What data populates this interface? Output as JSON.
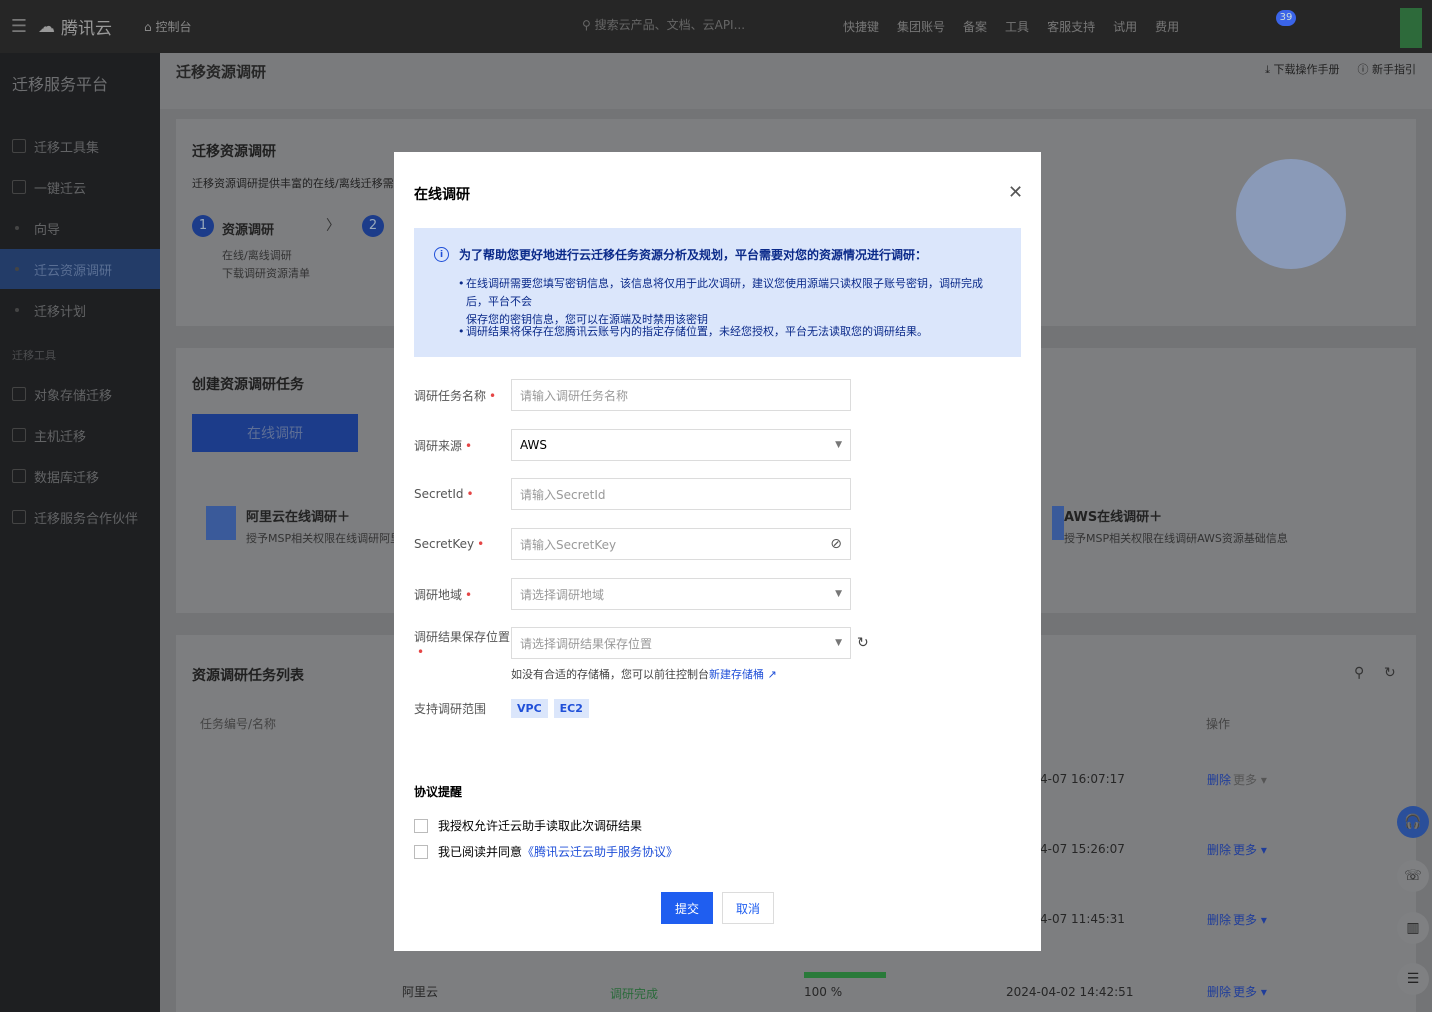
{
  "topbar": {
    "logo_text": "腾讯云",
    "console": "控制台",
    "search_placeholder": "搜索云产品、文档、云API...",
    "nav": [
      "快捷键",
      "集团账号",
      "备案",
      "工具",
      "客服支持",
      "试用",
      "费用"
    ],
    "notification_count": "39"
  },
  "sidebar": {
    "title": "迁移服务平台",
    "items": [
      "迁移工具集",
      "一键迁云",
      "向导",
      "迁云资源调研",
      "迁移计划"
    ],
    "section_label": "迁移工具",
    "tools": [
      "对象存储迁移",
      "主机迁移",
      "数据库迁移",
      "迁移服务合作伙伴"
    ]
  },
  "main": {
    "page_title": "迁移资源调研",
    "download_manual": "下载操作手册",
    "guide": "新手指引",
    "intro_title": "迁移资源调研",
    "intro_desc": "迁移资源调研提供丰富的在线/离线迁移需求调研",
    "step1_num": "1",
    "step1_title": "资源调研",
    "step1_desc1": "在线/离线调研",
    "step1_desc2": "下载调研资源清单",
    "step2_num": "2",
    "create_title": "创建资源调研任务",
    "create_tab": "在线调研",
    "aliyun_title": "阿里云在线调研＋",
    "aliyun_desc": "授予MSP相关权限在线调研阿里云",
    "aws_title": "AWS在线调研＋",
    "aws_desc": "授予MSP相关权限在线调研AWS资源基础信息",
    "list_title": "资源调研任务列表",
    "col_name": "任务编号/名称",
    "col_op": "操作",
    "rows": [
      {
        "time": "4-07 16:07:17",
        "del": "删除",
        "more": "更多"
      },
      {
        "time": "4-07 15:26:07",
        "del": "删除",
        "more": "更多"
      },
      {
        "time": "4-07 11:45:31",
        "del": "删除",
        "more": "更多"
      },
      {
        "source": "阿里云",
        "status": "调研完成",
        "progress": "100 %",
        "time": "2024-04-02 14:42:51",
        "del": "删除",
        "more": "更多"
      }
    ]
  },
  "modal": {
    "title": "在线调研",
    "notice_head": "为了帮助您更好地进行云迁移任务资源分析及规划，平台需要对您的资源情况进行调研：",
    "notice_p1a": "在线调研需要您填写密钥信息，该信息将仅用于此次调研，建议您使用源端只读权限子账号密钥，调研完成后，平台不会",
    "notice_p1b": "保存您的密钥信息，您可以在源端及时禁用该密钥",
    "notice_p2": "调研结果将保存在您腾讯云账号内的指定存储位置，未经您授权，平台无法读取您的调研结果。",
    "fields": {
      "name_label": "调研任务名称",
      "name_placeholder": "请输入调研任务名称",
      "source_label": "调研来源",
      "source_value": "AWS",
      "sid_label": "SecretId",
      "sid_placeholder": "请输入SecretId",
      "skey_label": "SecretKey",
      "skey_placeholder": "请输入SecretKey",
      "region_label": "调研地域",
      "region_placeholder": "请选择调研地域",
      "store_label": "调研结果保存位置",
      "store_placeholder": "请选择调研结果保存位置",
      "hint_text": "如没有合适的存储桶，您可以前往控制台",
      "hint_link": "新建存储桶",
      "scope_label": "支持调研范围",
      "scope_tags": [
        "VPC",
        "EC2"
      ]
    },
    "agreement_title": "协议提醒",
    "check1": "我授权允许迁云助手读取此次调研结果",
    "check2_prefix": "我已阅读并同意",
    "check2_link": "《腾讯云迁云助手服务协议》",
    "submit": "提交",
    "cancel": "取消"
  }
}
